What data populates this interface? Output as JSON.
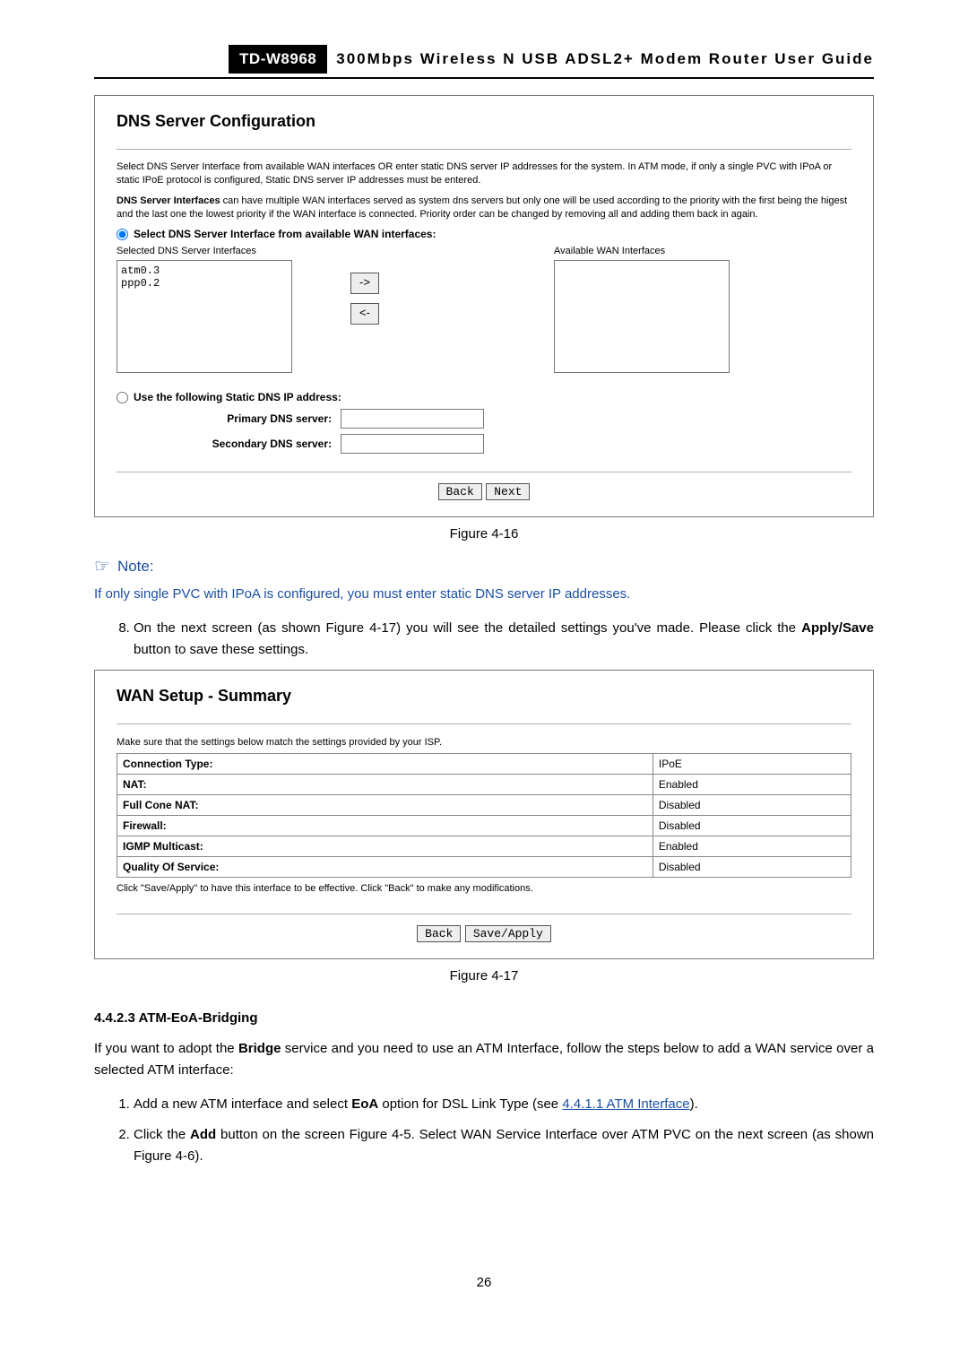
{
  "header": {
    "model": "TD-W8968",
    "title": "300Mbps Wireless N USB ADSL2+ Modem Router User Guide"
  },
  "fig1": {
    "heading": "DNS Server Configuration",
    "desc_line1": "Select DNS Server Interface from available WAN interfaces OR enter static DNS server IP addresses for the system. In ATM mode, if only a single PVC with IPoA or static IPoE protocol is configured, Static DNS server IP addresses must be entered.",
    "desc_line2_strong": "DNS Server Interfaces",
    "desc_line2_rest": " can have multiple WAN interfaces served as system dns servers but only one will be used according to the priority with the first being the higest and the last one the lowest priority if the WAN interface is connected. Priority order can be changed by removing all and adding them back in again.",
    "radio1": "Select DNS Server Interface from available WAN interfaces:",
    "col1_label": "Selected DNS Server Interfaces",
    "col2_label": "Available WAN Interfaces",
    "listbox_items": "atm0.3\nppp0.2",
    "arrow_right": "->",
    "arrow_left": "<-",
    "radio2": "Use the following Static DNS IP address:",
    "primary_label": "Primary DNS server:",
    "secondary_label": "Secondary DNS server:",
    "btn_back": "Back",
    "btn_next": "Next",
    "caption": "Figure 4-16"
  },
  "note": {
    "label": "Note:",
    "text": "If only single PVC with IPoA is configured, you must enter static DNS server IP addresses."
  },
  "step8": {
    "text_a": "On the next screen (as shown Figure 4-17) you will see the detailed settings you've made. Please click the ",
    "text_strong": "Apply/Save",
    "text_b": " button to save these settings."
  },
  "fig2": {
    "heading": "WAN Setup - Summary",
    "intro": "Make sure that the settings below match the settings provided by your ISP.",
    "rows": [
      {
        "label": "Connection Type:",
        "value": "IPoE"
      },
      {
        "label": "NAT:",
        "value": "Enabled"
      },
      {
        "label": "Full Cone NAT:",
        "value": "Disabled"
      },
      {
        "label": "Firewall:",
        "value": "Disabled"
      },
      {
        "label": "IGMP Multicast:",
        "value": "Enabled"
      },
      {
        "label": "Quality Of Service:",
        "value": "Disabled"
      }
    ],
    "foot": "Click \"Save/Apply\" to have this interface to be effective. Click \"Back\" to make any modifications.",
    "btn_back": "Back",
    "btn_save": "Save/Apply",
    "caption": "Figure 4-17"
  },
  "section": {
    "heading": "4.4.2.3  ATM-EoA-Bridging",
    "intro_a": "If you want to adopt the ",
    "intro_strong": "Bridge",
    "intro_b": " service and you need to use an ATM Interface, follow the steps below to add a WAN service over a selected ATM interface:",
    "step1_a": "Add a new ATM interface and select ",
    "step1_strong": "EoA",
    "step1_b": " option for DSL Link Type (see ",
    "step1_link": "4.4.1.1 ATM Interface",
    "step1_c": ").",
    "step2_a": "Click the ",
    "step2_strong": "Add",
    "step2_b": " button on the screen Figure 4-5. Select WAN Service Interface over ATM PVC on the next screen (as shown Figure 4-6)."
  },
  "pagenum": "26"
}
